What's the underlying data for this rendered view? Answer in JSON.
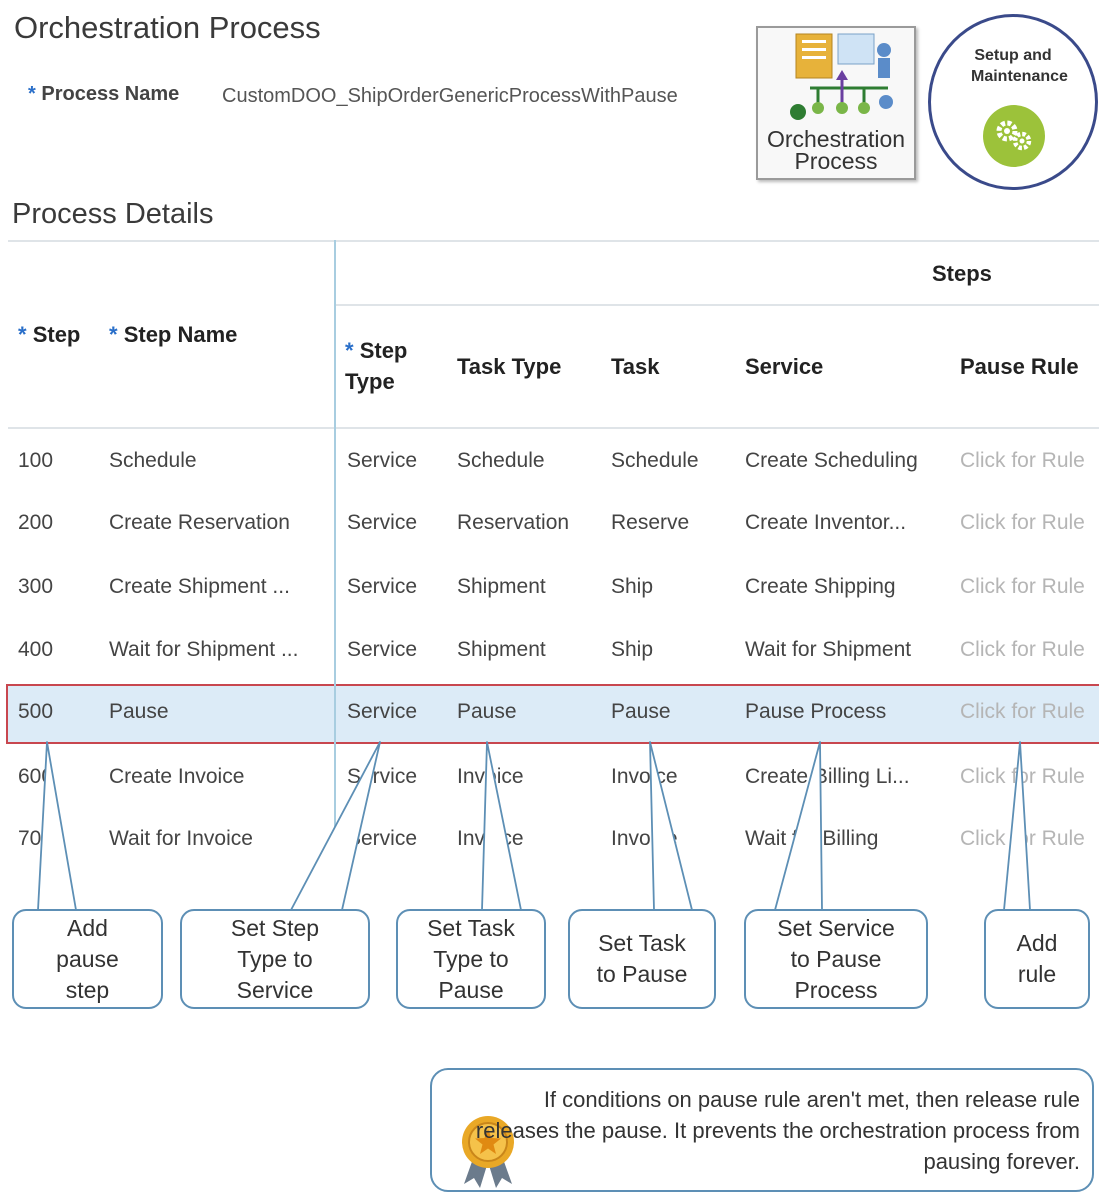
{
  "page_title": "Orchestration Process",
  "process_name": {
    "label": "Process Name",
    "value": "CustomDOO_ShipOrderGenericProcessWithPause"
  },
  "logos": {
    "orchestration": "Orchestration Process",
    "setup": "Setup and Maintenance"
  },
  "section_title": "Process Details",
  "table": {
    "group_header": "Steps",
    "headers": {
      "step": "Step",
      "step_name": "Step Name",
      "step_type": "Step Type",
      "task_type": "Task Type",
      "task": "Task",
      "service": "Service",
      "pause_rule": "Pause Rule"
    },
    "rows": [
      {
        "step": "100",
        "name": "Schedule",
        "type": "Service",
        "task_type": "Schedule",
        "task": "Schedule",
        "service": "Create Scheduling",
        "rule": "Click for Rule"
      },
      {
        "step": "200",
        "name": "Create Reservation",
        "type": "Service",
        "task_type": "Reservation",
        "task": "Reserve",
        "service": "Create Inventor...",
        "rule": "Click for Rule"
      },
      {
        "step": "300",
        "name": "Create Shipment ...",
        "type": "Service",
        "task_type": "Shipment",
        "task": "Ship",
        "service": "Create Shipping",
        "rule": "Click for Rule"
      },
      {
        "step": "400",
        "name": "Wait for Shipment ...",
        "type": "Service",
        "task_type": "Shipment",
        "task": "Ship",
        "service": "Wait for Shipment",
        "rule": "Click for Rule"
      },
      {
        "step": "500",
        "name": "Pause",
        "type": "Service",
        "task_type": "Pause",
        "task": "Pause",
        "service": "Pause Process",
        "rule": "Click for Rule"
      },
      {
        "step": "600",
        "name": "Create Invoice",
        "type": "Service",
        "task_type": "Invoice",
        "task": "Invoice",
        "service": "Create Billing Li...",
        "rule": "Click for Rule"
      },
      {
        "step": "700",
        "name": "Wait for Invoice",
        "type": "Service",
        "task_type": "Invoice",
        "task": "Invoice",
        "service": "Wait for Billing",
        "rule": "Click for Rule"
      }
    ]
  },
  "callouts": {
    "add_pause_step": "Add pause step",
    "set_step_type": "Set Step Type to Service",
    "set_task_type": "Set Task Type to Pause",
    "set_task": "Set Task to Pause",
    "set_service": "Set Service to Pause Process",
    "add_rule": "Add rule"
  },
  "note": "If conditions on pause rule aren't met, then release rule releases the pause. It prevents the orchestration process from pausing forever.",
  "colors": {
    "selection": "#dcebf7",
    "selection_border": "#c8474f",
    "callout_border": "#5d8fb5",
    "required_star": "#2a6fc9",
    "link_disabled": "#b5b5b5"
  }
}
